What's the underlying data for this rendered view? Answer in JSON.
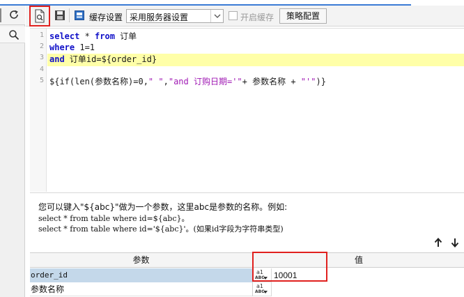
{
  "toolbar": {
    "cache_label": "缓存设置",
    "cache_select_value": "采用服务器设置",
    "enable_cache_label": "开启缓存",
    "policy_button_label": "策略配置"
  },
  "editor": {
    "line_numbers": [
      "1",
      "2",
      "3",
      "4",
      "5"
    ],
    "lines": [
      {
        "kw": "select",
        "rest": " * ",
        "kw2": "from",
        "tail": " 订单"
      },
      {
        "kw": "where",
        "rest": " 1=1",
        "kw2": "",
        "tail": ""
      },
      {
        "kw": "and",
        "rest": " 订单id=${order_id}",
        "kw2": "",
        "tail": ""
      },
      {
        "kw": "",
        "rest": "",
        "kw2": "",
        "tail": ""
      },
      {
        "pre": "${if(len(参数名称)=0,",
        "s1": "\" \"",
        "mid": ",",
        "s2": "\"and 订购日期='\"",
        "mid2": "+ 参数名称 + ",
        "s3": "\"'\"",
        "end": ")}"
      }
    ]
  },
  "help": {
    "line1": "您可以键入\"${abc}\"做为一个参数，这里abc是参数的名称。例如:",
    "line2": "select * from table where id=${abc}。",
    "line3": "select * from table where id='${abc}'。(如果id字段为字符串类型)"
  },
  "params": {
    "header_param": "参数",
    "header_value": "值",
    "rows": [
      {
        "name": "order_id",
        "type_top": "a1",
        "type_bot": "ABC",
        "value": "10001"
      },
      {
        "name": "参数名称",
        "type_top": "a1",
        "type_bot": "ABC",
        "value": ""
      }
    ]
  },
  "colors": {
    "highlight_box": "#e0201e",
    "keyword": "#1010c8",
    "string": "#a01ab4",
    "current_line": "#ffffa8",
    "selected_row": "#c4d8ea"
  }
}
